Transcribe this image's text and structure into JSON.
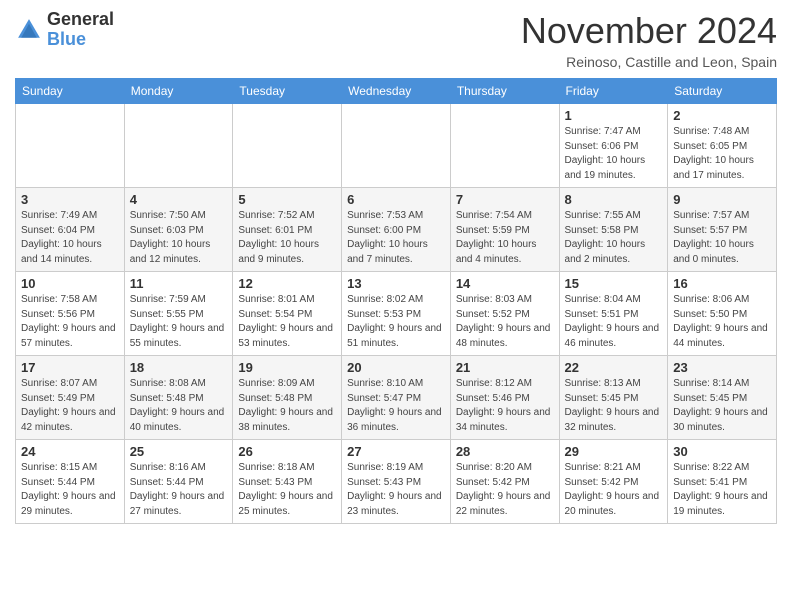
{
  "header": {
    "logo": {
      "general": "General",
      "blue": "Blue"
    },
    "title": "November 2024",
    "location": "Reinoso, Castille and Leon, Spain"
  },
  "weekdays": [
    "Sunday",
    "Monday",
    "Tuesday",
    "Wednesday",
    "Thursday",
    "Friday",
    "Saturday"
  ],
  "weeks": [
    [
      {
        "day": "",
        "info": ""
      },
      {
        "day": "",
        "info": ""
      },
      {
        "day": "",
        "info": ""
      },
      {
        "day": "",
        "info": ""
      },
      {
        "day": "",
        "info": ""
      },
      {
        "day": "1",
        "info": "Sunrise: 7:47 AM\nSunset: 6:06 PM\nDaylight: 10 hours and 19 minutes."
      },
      {
        "day": "2",
        "info": "Sunrise: 7:48 AM\nSunset: 6:05 PM\nDaylight: 10 hours and 17 minutes."
      }
    ],
    [
      {
        "day": "3",
        "info": "Sunrise: 7:49 AM\nSunset: 6:04 PM\nDaylight: 10 hours and 14 minutes."
      },
      {
        "day": "4",
        "info": "Sunrise: 7:50 AM\nSunset: 6:03 PM\nDaylight: 10 hours and 12 minutes."
      },
      {
        "day": "5",
        "info": "Sunrise: 7:52 AM\nSunset: 6:01 PM\nDaylight: 10 hours and 9 minutes."
      },
      {
        "day": "6",
        "info": "Sunrise: 7:53 AM\nSunset: 6:00 PM\nDaylight: 10 hours and 7 minutes."
      },
      {
        "day": "7",
        "info": "Sunrise: 7:54 AM\nSunset: 5:59 PM\nDaylight: 10 hours and 4 minutes."
      },
      {
        "day": "8",
        "info": "Sunrise: 7:55 AM\nSunset: 5:58 PM\nDaylight: 10 hours and 2 minutes."
      },
      {
        "day": "9",
        "info": "Sunrise: 7:57 AM\nSunset: 5:57 PM\nDaylight: 10 hours and 0 minutes."
      }
    ],
    [
      {
        "day": "10",
        "info": "Sunrise: 7:58 AM\nSunset: 5:56 PM\nDaylight: 9 hours and 57 minutes."
      },
      {
        "day": "11",
        "info": "Sunrise: 7:59 AM\nSunset: 5:55 PM\nDaylight: 9 hours and 55 minutes."
      },
      {
        "day": "12",
        "info": "Sunrise: 8:01 AM\nSunset: 5:54 PM\nDaylight: 9 hours and 53 minutes."
      },
      {
        "day": "13",
        "info": "Sunrise: 8:02 AM\nSunset: 5:53 PM\nDaylight: 9 hours and 51 minutes."
      },
      {
        "day": "14",
        "info": "Sunrise: 8:03 AM\nSunset: 5:52 PM\nDaylight: 9 hours and 48 minutes."
      },
      {
        "day": "15",
        "info": "Sunrise: 8:04 AM\nSunset: 5:51 PM\nDaylight: 9 hours and 46 minutes."
      },
      {
        "day": "16",
        "info": "Sunrise: 8:06 AM\nSunset: 5:50 PM\nDaylight: 9 hours and 44 minutes."
      }
    ],
    [
      {
        "day": "17",
        "info": "Sunrise: 8:07 AM\nSunset: 5:49 PM\nDaylight: 9 hours and 42 minutes."
      },
      {
        "day": "18",
        "info": "Sunrise: 8:08 AM\nSunset: 5:48 PM\nDaylight: 9 hours and 40 minutes."
      },
      {
        "day": "19",
        "info": "Sunrise: 8:09 AM\nSunset: 5:48 PM\nDaylight: 9 hours and 38 minutes."
      },
      {
        "day": "20",
        "info": "Sunrise: 8:10 AM\nSunset: 5:47 PM\nDaylight: 9 hours and 36 minutes."
      },
      {
        "day": "21",
        "info": "Sunrise: 8:12 AM\nSunset: 5:46 PM\nDaylight: 9 hours and 34 minutes."
      },
      {
        "day": "22",
        "info": "Sunrise: 8:13 AM\nSunset: 5:45 PM\nDaylight: 9 hours and 32 minutes."
      },
      {
        "day": "23",
        "info": "Sunrise: 8:14 AM\nSunset: 5:45 PM\nDaylight: 9 hours and 30 minutes."
      }
    ],
    [
      {
        "day": "24",
        "info": "Sunrise: 8:15 AM\nSunset: 5:44 PM\nDaylight: 9 hours and 29 minutes."
      },
      {
        "day": "25",
        "info": "Sunrise: 8:16 AM\nSunset: 5:44 PM\nDaylight: 9 hours and 27 minutes."
      },
      {
        "day": "26",
        "info": "Sunrise: 8:18 AM\nSunset: 5:43 PM\nDaylight: 9 hours and 25 minutes."
      },
      {
        "day": "27",
        "info": "Sunrise: 8:19 AM\nSunset: 5:43 PM\nDaylight: 9 hours and 23 minutes."
      },
      {
        "day": "28",
        "info": "Sunrise: 8:20 AM\nSunset: 5:42 PM\nDaylight: 9 hours and 22 minutes."
      },
      {
        "day": "29",
        "info": "Sunrise: 8:21 AM\nSunset: 5:42 PM\nDaylight: 9 hours and 20 minutes."
      },
      {
        "day": "30",
        "info": "Sunrise: 8:22 AM\nSunset: 5:41 PM\nDaylight: 9 hours and 19 minutes."
      }
    ]
  ]
}
